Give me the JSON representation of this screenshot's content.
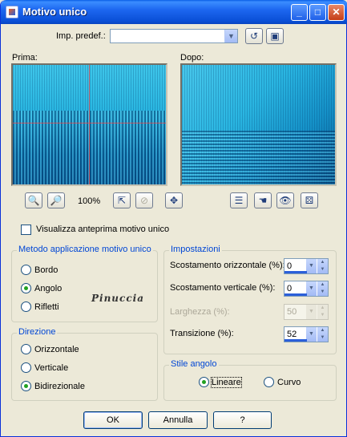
{
  "window": {
    "title": "Motivo unico",
    "minimize_icon": "minimize-icon",
    "maximize_icon": "maximize-icon",
    "close_icon": "close-icon"
  },
  "preset": {
    "label": "Imp. predef.:",
    "value": ""
  },
  "previews": {
    "before_label": "Prima:",
    "after_label": "Dopo:"
  },
  "zoom": {
    "level": "100%"
  },
  "show_preview": {
    "label": "Visualizza anteprima motivo unico",
    "checked": false
  },
  "method_group": {
    "title": "Metodo applicazione motivo unico",
    "options": [
      "Bordo",
      "Angolo",
      "Rifletti"
    ],
    "selected": "Angolo"
  },
  "watermark": "Pinuccia",
  "direction_group": {
    "title": "Direzione",
    "options": [
      "Orizzontale",
      "Verticale",
      "Bidirezionale"
    ],
    "selected": "Bidirezionale"
  },
  "settings_group": {
    "title": "Impostazioni",
    "horizontal_offset": {
      "label": "Scostamento orizzontale (%):",
      "value": "0"
    },
    "vertical_offset": {
      "label": "Scostamento verticale (%):",
      "value": "0"
    },
    "width": {
      "label": "Larghezza (%):",
      "value": "50"
    },
    "transition": {
      "label": "Transizione (%):",
      "value": "52"
    }
  },
  "corner_style_group": {
    "title": "Stile angolo",
    "options": [
      "Lineare",
      "Curvo"
    ],
    "selected": "Lineare"
  },
  "buttons": {
    "ok": "OK",
    "cancel": "Annulla",
    "help": "?"
  },
  "colors": {
    "titlebar": "#0a4fd6",
    "dialog_bg": "#ece9d8",
    "group_title": "#0046d5"
  }
}
